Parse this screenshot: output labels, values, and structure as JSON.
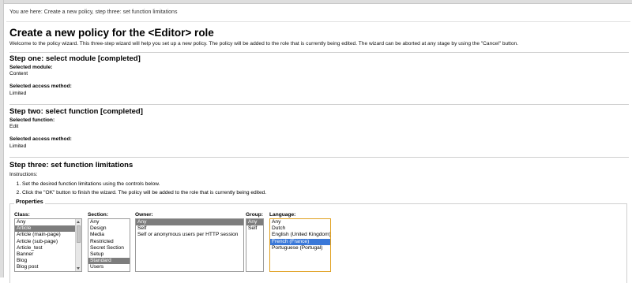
{
  "breadcrumb": "You are here: Create a new policy, step three: set function limitations",
  "page_title": "Create a new policy for the <Editor> role",
  "intro": "Welcome to the policy wizard. This three-step wizard will help you set up a new policy. The policy will be added to the role that is currently being edited. The wizard can be aborted at any stage by using the \"Cancel\" button.",
  "step1": {
    "title": "Step one: select module [completed]",
    "module_label": "Selected module:",
    "module_value": "Content",
    "access_label": "Selected access method:",
    "access_value": "Limited"
  },
  "step2": {
    "title": "Step two: select function [completed]",
    "function_label": "Selected function:",
    "function_value": "Edit",
    "access_label": "Selected access method:",
    "access_value": "Limited"
  },
  "step3": {
    "title": "Step three: set function limitations",
    "instructions_label": "Instructions:",
    "instructions": [
      "Set the desired function limitations using the controls below.",
      "Click the \"OK\" button to finish the wizard. The policy will be added to the role that is currently being edited."
    ]
  },
  "properties": {
    "legend": "Properties",
    "class": {
      "label": "Class:",
      "options": [
        "Any",
        "Article",
        "Article (main-page)",
        "Article (sub-page)",
        "Article_test",
        "Banner",
        "Blog",
        "Blog post"
      ],
      "selected": "Article"
    },
    "section": {
      "label": "Section:",
      "options": [
        "Any",
        "Design",
        "Media",
        "Restricted",
        "Secret Section",
        "Setup",
        "Standard",
        "Users"
      ],
      "selected": "Standard"
    },
    "owner": {
      "label": "Owner:",
      "options": [
        "Any",
        "Self",
        "Self or anonymous users per HTTP session"
      ],
      "selected": "Any"
    },
    "group": {
      "label": "Group:",
      "options": [
        "Any",
        "Self"
      ],
      "selected": "Any"
    },
    "language": {
      "label": "Language:",
      "options": [
        "Any",
        "Dutch",
        "English (United Kingdom)",
        "French (France)",
        "Portuguese (Portugal)"
      ],
      "selected": "French (France)"
    }
  }
}
